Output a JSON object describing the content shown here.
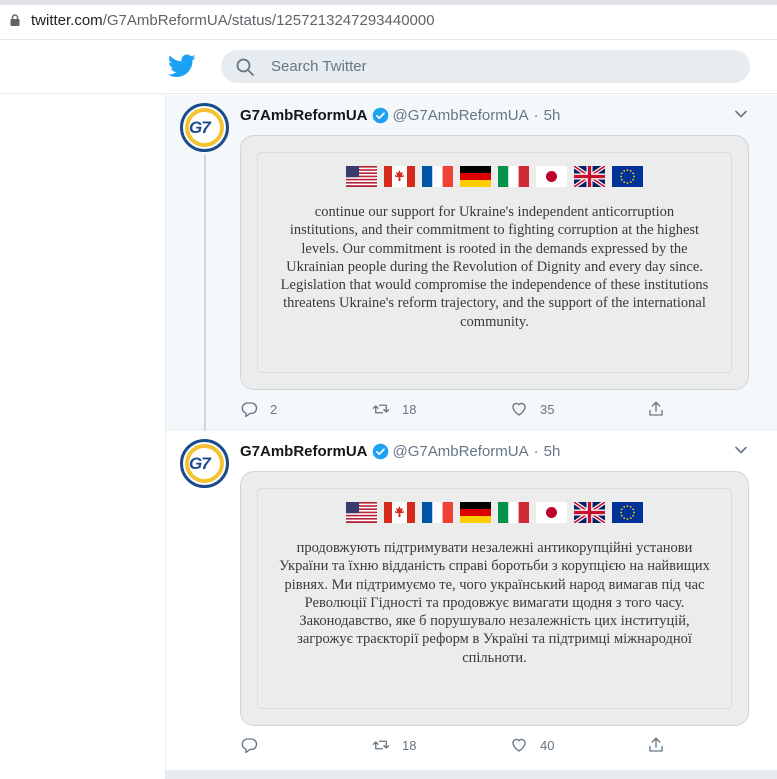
{
  "browser": {
    "url_domain": "twitter.com",
    "url_path": "/G7AmbReformUA/status/1257213247293440000"
  },
  "header": {
    "search_placeholder": "Search Twitter",
    "brand_color": "#1da1f2"
  },
  "tweets": [
    {
      "name": "G7AmbReformUA",
      "handle": "@G7AmbReformUA",
      "time": "5h",
      "flags": [
        "us-flag",
        "canada-flag",
        "france-flag",
        "germany-flag",
        "italy-flag",
        "japan-flag",
        "uk-flag",
        "eu-flag"
      ],
      "image_text": "continue our support for Ukraine's independent anticorruption institutions, and their commitment to fighting corruption at the highest levels. Our commitment is rooted in the demands expressed by the Ukrainian people during the Revolution of Dignity and every day since. Legislation that would compromise the independence of these institutions threatens Ukraine's reform trajectory, and the support of the international community.",
      "replies": "2",
      "retweets": "18",
      "likes": "35"
    },
    {
      "name": "G7AmbReformUA",
      "handle": "@G7AmbReformUA",
      "time": "5h",
      "flags": [
        "us-flag",
        "canada-flag",
        "france-flag",
        "germany-flag",
        "italy-flag",
        "japan-flag",
        "uk-flag",
        "eu-flag"
      ],
      "image_text": "продовжують підтримувати незалежні антикорупційні установи України та їхню відданість справі боротьби з корупцією на найвищих рівнях. Ми підтримуємо те, чого український народ вимагав під час Революції Гідності та продовжує вимагати щодня з того часу. Законодавство, яке б порушувало незалежність цих інституцій, загрожує траєкторії реформ в Україні та підтримці міжнародної спільноти.",
      "replies": "",
      "retweets": "18",
      "likes": "40"
    }
  ]
}
